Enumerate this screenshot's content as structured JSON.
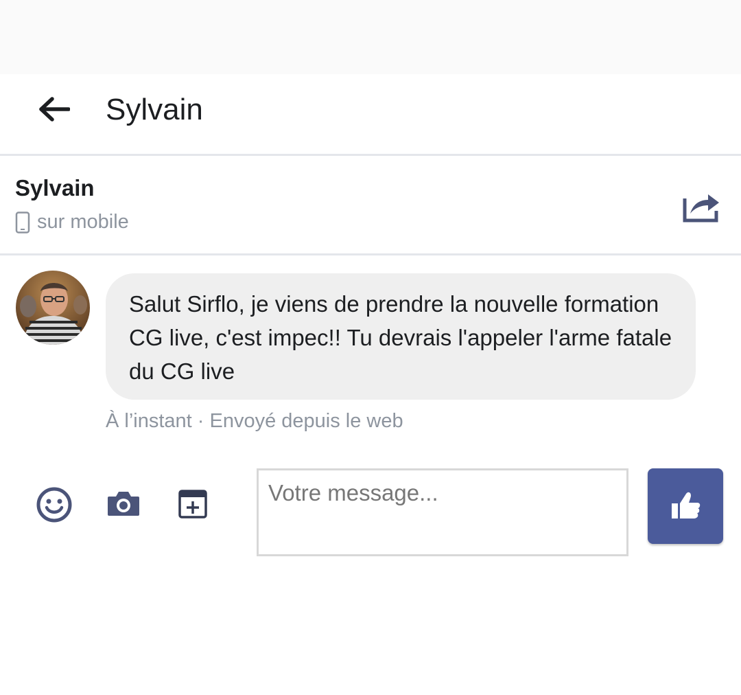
{
  "header": {
    "title": "Sylvain"
  },
  "contact": {
    "name": "Sylvain",
    "status": "sur mobile"
  },
  "message": {
    "text": "Salut Sirflo, je viens de prendre la nouvelle formation CG live, c'est impec!! Tu devrais l'appeler l'arme fatale du CG live",
    "meta": "À l’instant · Envoyé depuis le web"
  },
  "composer": {
    "placeholder": "Votre message...",
    "icons": [
      "smiley-icon",
      "camera-icon",
      "sticker-add-icon",
      "thumbs-up-icon"
    ]
  },
  "colors": {
    "accent": "#4b5b9b",
    "icon": "#4b5479",
    "muted_text": "#8d949e",
    "bubble": "#efefef"
  }
}
